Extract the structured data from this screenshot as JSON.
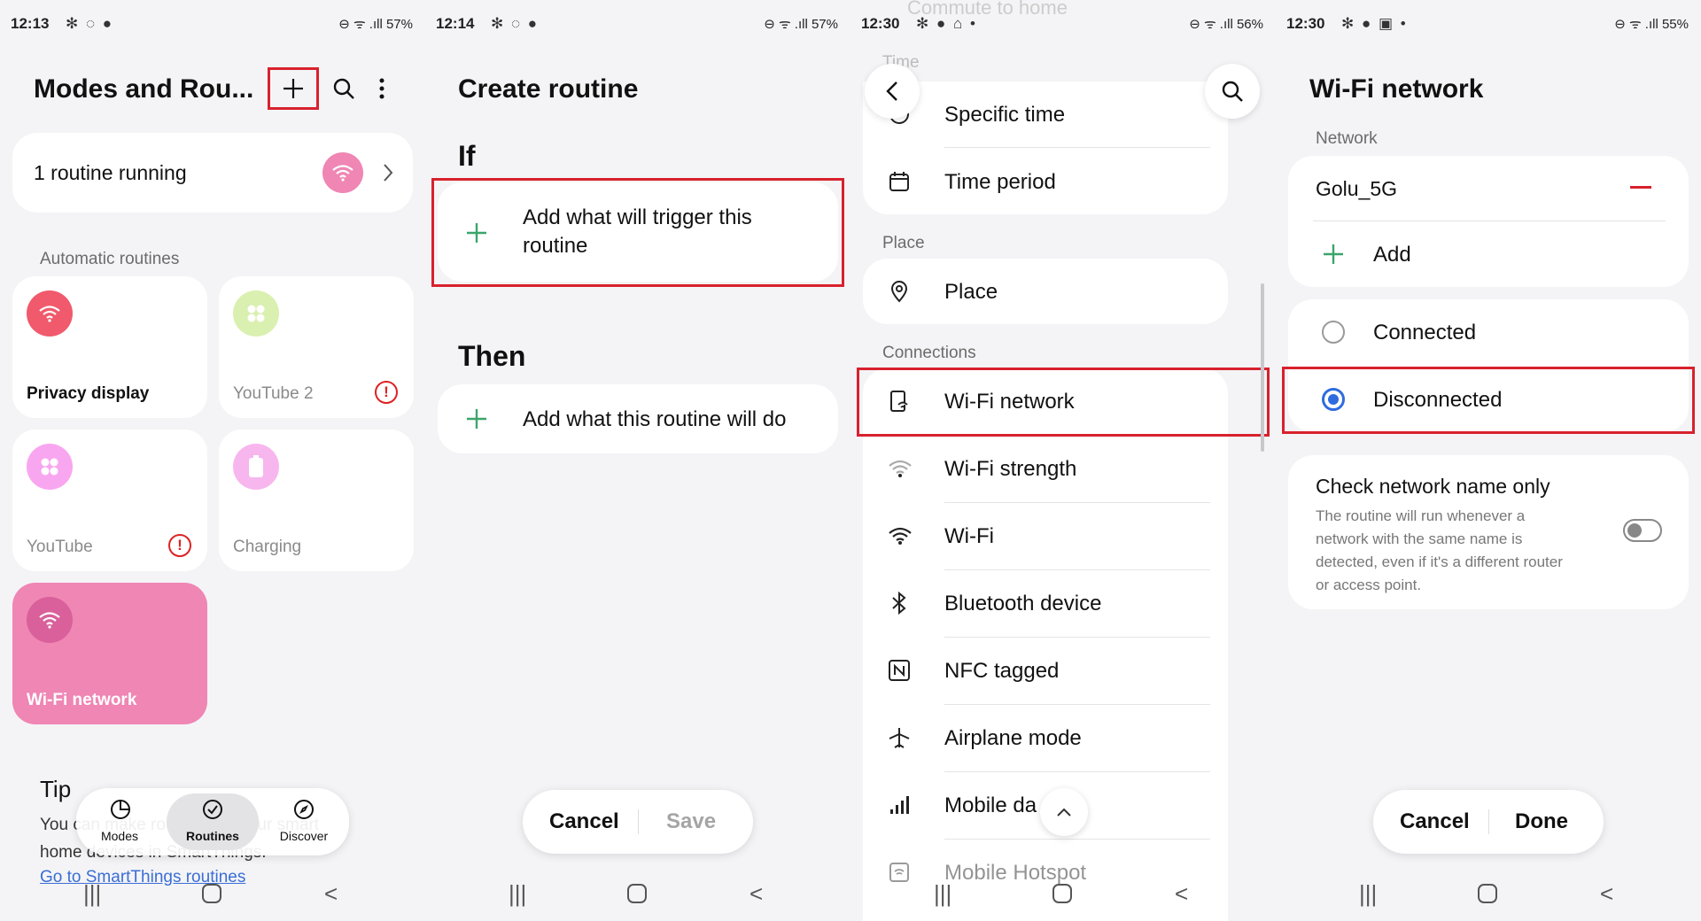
{
  "panel1": {
    "status": {
      "time": "12:13",
      "notif": "✻ ◌ ●",
      "right": "⊖ ᯤ .ıll 57%"
    },
    "title": "Modes and Rou...",
    "running": {
      "label": "1 routine running"
    },
    "section_label": "Automatic routines",
    "tiles": [
      {
        "name": "Privacy display",
        "color": "#f05a6c"
      },
      {
        "name": "YouTube 2",
        "color": "#d9f0b0"
      },
      {
        "name": "YouTube",
        "color": "#f9a6f0"
      },
      {
        "name": "Charging",
        "color": "#f7b6ee"
      },
      {
        "name": "Wi-Fi network",
        "color": "#ef86b4"
      }
    ],
    "tip": {
      "title": "Tip",
      "text": "You can make routines for your smart home devices in SmartThings.",
      "link": "Go to SmartThings routines"
    },
    "bottom_nav": [
      "Modes",
      "Routines",
      "Discover"
    ]
  },
  "panel2": {
    "status": {
      "time": "12:14",
      "notif": "✻ ◌ ●",
      "right": "⊖ ᯤ .ıll 57%"
    },
    "title": "Create routine",
    "if_label": "If",
    "if_action": "Add what will trigger this routine",
    "then_label": "Then",
    "then_action": "Add what this routine will do",
    "cancel": "Cancel",
    "save": "Save"
  },
  "panel3": {
    "status": {
      "time": "12:30",
      "notif": "✻ ● ⌂ •",
      "right": "⊖ ᯤ .ıll 56%"
    },
    "top_hidden": "Commute to home",
    "time_label": "Time",
    "time_items": [
      "Specific time",
      "Time period"
    ],
    "place_label": "Place",
    "place_items": [
      "Place"
    ],
    "connections_label": "Connections",
    "connection_items": [
      "Wi-Fi network",
      "Wi-Fi strength",
      "Wi-Fi",
      "Bluetooth device",
      "NFC tagged",
      "Airplane mode",
      "Mobile da",
      "Mobile Hotspot"
    ]
  },
  "panel4": {
    "status": {
      "time": "12:30",
      "notif": "✻ ● ▣ •",
      "right": "⊖ ᯤ .ıll 55%"
    },
    "title": "Wi-Fi network",
    "network_label": "Network",
    "network_name": "Golu_5G",
    "add_label": "Add",
    "options": [
      "Connected",
      "Disconnected"
    ],
    "check_title": "Check network name only",
    "check_desc": "The routine will run whenever a network with the same name is detected, even if it's a different router or access point.",
    "cancel": "Cancel",
    "done": "Done"
  }
}
